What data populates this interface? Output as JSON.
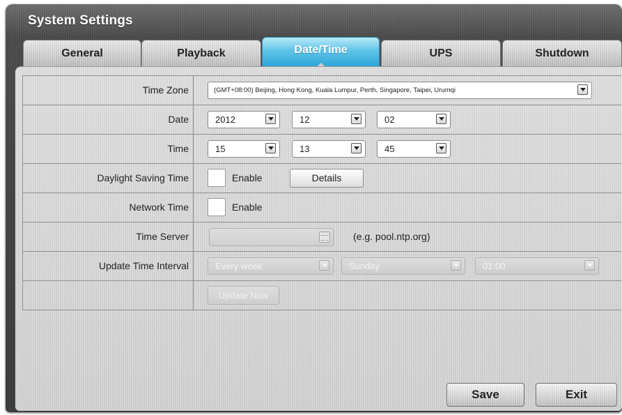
{
  "window": {
    "title": "System Settings"
  },
  "tabs": [
    {
      "label": "General",
      "active": false
    },
    {
      "label": "Playback",
      "active": false
    },
    {
      "label": "Date/Time",
      "active": true
    },
    {
      "label": "UPS",
      "active": false
    },
    {
      "label": "Shutdown",
      "active": false
    }
  ],
  "form": {
    "time_zone": {
      "label": "Time Zone",
      "value": "(GMT+08:00) Beijing, Hong Kong, Kuala Lumpur, Perth, Singapore, Taipei, Urumqi"
    },
    "date": {
      "label": "Date",
      "year": "2012",
      "month": "12",
      "day": "02"
    },
    "time": {
      "label": "Time",
      "hour": "15",
      "minute": "13",
      "second": "45"
    },
    "dst": {
      "label": "Daylight Saving Time",
      "enable_label": "Enable",
      "enabled": false,
      "details_label": "Details"
    },
    "network_time": {
      "label": "Network Time",
      "enable_label": "Enable",
      "enabled": false
    },
    "time_server": {
      "label": "Time Server",
      "value": "",
      "hint": "(e.g. pool.ntp.org)",
      "icon": "keyboard-icon"
    },
    "update_interval": {
      "label": "Update Time Interval",
      "frequency": "Every week",
      "weekday": "Sunday",
      "time": "01:00"
    },
    "update_now_label": "Update Now"
  },
  "footer": {
    "save_label": "Save",
    "exit_label": "Exit"
  },
  "colors": {
    "active_tab": "#3cb0df",
    "title_bar": "#4a4a4a",
    "panel": "#d6d6d6"
  }
}
